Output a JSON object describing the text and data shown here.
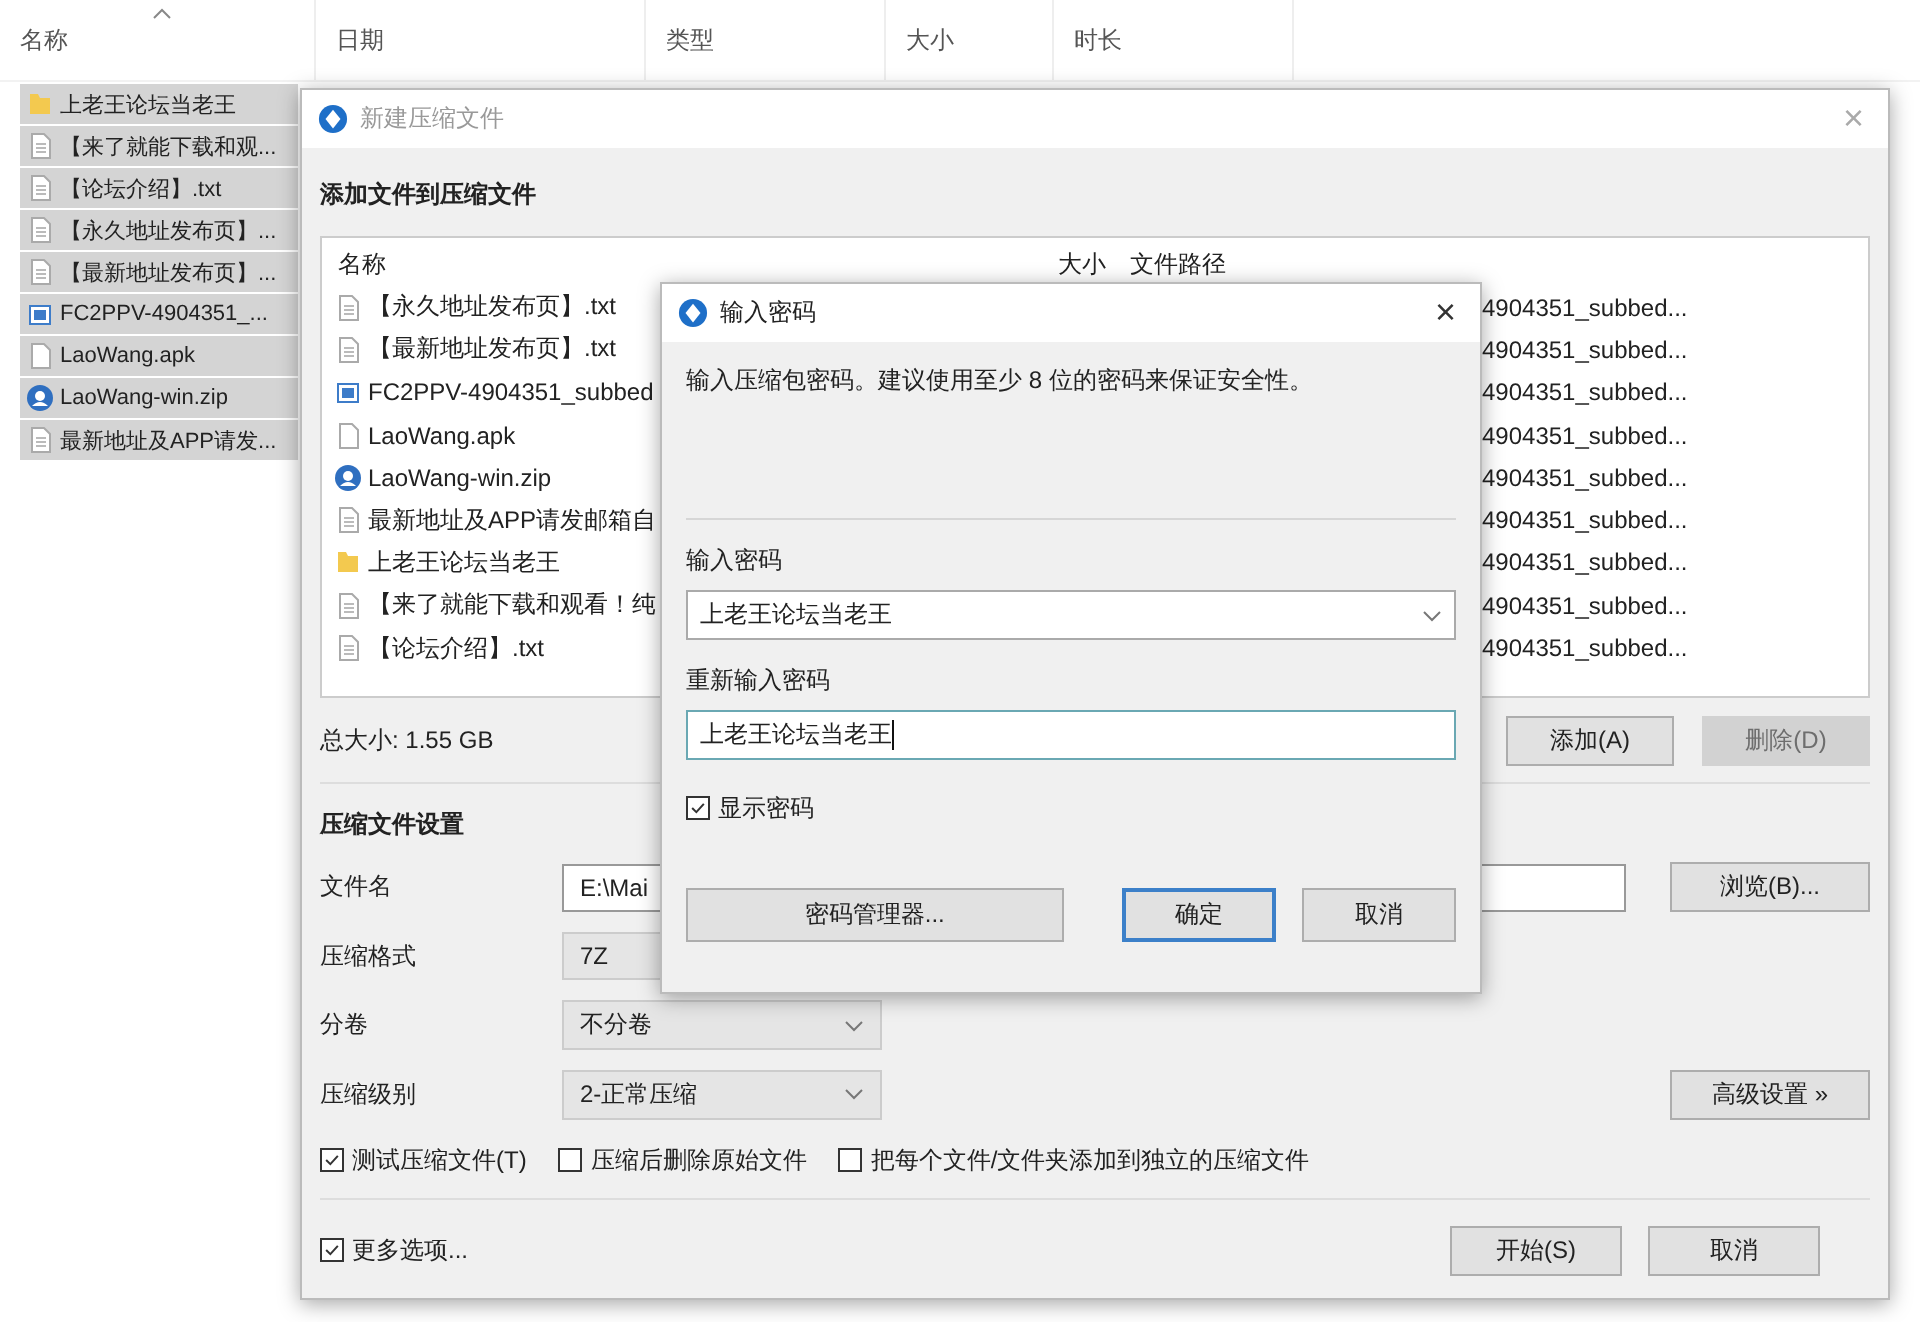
{
  "explorer": {
    "columns": [
      {
        "label": "名称",
        "sorted": true
      },
      {
        "label": "日期",
        "sorted": false
      },
      {
        "label": "类型",
        "sorted": false
      },
      {
        "label": "大小",
        "sorted": false
      },
      {
        "label": "时长",
        "sorted": false
      }
    ],
    "rows": [
      {
        "name": "上老王论坛当老王",
        "kind": "folder",
        "selected": true
      },
      {
        "name": "【来了就能下载和观...",
        "kind": "text",
        "selected": true
      },
      {
        "name": "【论坛介绍】.txt",
        "kind": "text",
        "selected": true
      },
      {
        "name": "【永久地址发布页】...",
        "kind": "text",
        "selected": true
      },
      {
        "name": "【最新地址发布页】...",
        "kind": "text",
        "selected": true
      },
      {
        "name": "FC2PPV-4904351_...",
        "kind": "video",
        "selected": true
      },
      {
        "name": "LaoWang.apk",
        "kind": "apk",
        "selected": true
      },
      {
        "name": "LaoWang-win.zip",
        "kind": "zip",
        "selected": true
      },
      {
        "name": "最新地址及APP请发...",
        "kind": "text",
        "selected": true
      }
    ]
  },
  "archive_dialog": {
    "title": "新建压缩文件",
    "active": false,
    "close": "×",
    "heading": "添加文件到压缩文件",
    "list_columns": [
      "名称",
      "大小",
      "文件路径"
    ],
    "files": [
      {
        "name": "【永久地址发布页】.txt",
        "kind": "text",
        "path": "4904351_subbed..."
      },
      {
        "name": "【最新地址发布页】.txt",
        "kind": "text",
        "path": "4904351_subbed..."
      },
      {
        "name": "FC2PPV-4904351_subbed",
        "kind": "video",
        "path": "4904351_subbed..."
      },
      {
        "name": "LaoWang.apk",
        "kind": "apk",
        "path": "4904351_subbed..."
      },
      {
        "name": "LaoWang-win.zip",
        "kind": "zip",
        "path": "4904351_subbed..."
      },
      {
        "name": "最新地址及APP请发邮箱自",
        "kind": "text",
        "path": "4904351_subbed..."
      },
      {
        "name": "上老王论坛当老王",
        "kind": "folder",
        "path": "4904351_subbed..."
      },
      {
        "name": "【来了就能下载和观看！纯",
        "kind": "text",
        "path": "4904351_subbed..."
      },
      {
        "name": "【论坛介绍】.txt",
        "kind": "text",
        "path": "4904351_subbed..."
      }
    ],
    "total_size": "总大小: 1.55 GB",
    "list_buttons": [
      {
        "label": "添加(A)",
        "disabled": false
      },
      {
        "label": "删除(D)",
        "disabled": true
      }
    ],
    "settings_heading": "压缩文件设置",
    "settings": [
      {
        "label": "文件名",
        "kind": "textbox",
        "value": "E:\\Mai",
        "button": "浏览(B)..."
      },
      {
        "label": "压缩格式",
        "kind": "partial",
        "value": "7Z"
      },
      {
        "label": "分卷",
        "kind": "dropdown",
        "value": "不分卷"
      },
      {
        "label": "压缩级别",
        "kind": "dropdown",
        "value": "2-正常压缩",
        "button": "高级设置 »"
      }
    ],
    "options": [
      {
        "label": "测试压缩文件(T)",
        "checked": true
      },
      {
        "label": "压缩后删除原始文件",
        "checked": false
      },
      {
        "label": "把每个文件/文件夹添加到独立的压缩文件",
        "checked": false
      }
    ],
    "more_options": {
      "label": "更多选项...",
      "checked": true
    },
    "actions": [
      "开始(S)",
      "取消"
    ]
  },
  "password_dialog": {
    "title": "输入密码",
    "close": "×",
    "message": "输入压缩包密码。建议使用至少 8 位的密码来保证安全性。",
    "fields": [
      {
        "label": "输入密码",
        "kind": "dropdown",
        "value": "上老王论坛当老王",
        "focused": false
      },
      {
        "label": "重新输入密码",
        "kind": "textbox",
        "value": "上老王论坛当老王",
        "focused": true
      }
    ],
    "show_password": {
      "label": "显示密码",
      "checked": true
    },
    "buttons": [
      {
        "label": "密码管理器...",
        "default": false
      },
      {
        "label": "确定",
        "default": true
      },
      {
        "label": "取消",
        "default": false
      }
    ]
  }
}
